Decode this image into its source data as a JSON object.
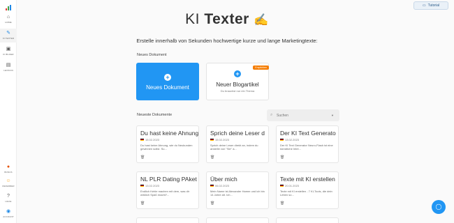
{
  "sidebar": {
    "items": [
      {
        "label": "Home",
        "icon": "home-icon",
        "glyph": "⌂"
      },
      {
        "label": "KI Texter",
        "icon": "pen-icon",
        "glyph": "✎"
      },
      {
        "label": "KI Bilder",
        "icon": "image-icon",
        "glyph": "▣"
      },
      {
        "label": "Lexikon",
        "icon": "book-icon",
        "glyph": "▤"
      }
    ],
    "bottom": [
      {
        "label": "Bonus",
        "icon": "gift-icon",
        "glyph": "●"
      },
      {
        "label": "Referrer",
        "icon": "smile-icon",
        "glyph": "☺"
      },
      {
        "label": "Hilfe",
        "icon": "help-icon",
        "glyph": "?"
      },
      {
        "label": "Account",
        "icon": "account-icon",
        "glyph": "◉"
      }
    ]
  },
  "header": {
    "tutorial_label": "Tutorial",
    "title_light": "KI ",
    "title_bold": "Texter",
    "title_emoji": "✍",
    "subtitle": "Erstelle innerhalb von Sekunden hochwertige kurze und lange Marketingtexte:"
  },
  "new_doc": {
    "section": "Neues Dokument",
    "primary_label": "Neues Dokument",
    "blog_label": "Neuer Blogartikel",
    "blog_sub": "Du brauchst nur ein Thema",
    "blog_badge": "Empfohlen"
  },
  "recent": {
    "section": "Neueste Dokumente",
    "search_placeholder": "Suchen",
    "docs": [
      {
        "title": "Du hast keine Ahnung",
        "date": "15.02.2023",
        "excerpt": "Du hast keine Ahnung, wie du Neukunden gewinnen sollst. Su..."
      },
      {
        "title": "Sprich deine Leser d",
        "date": "15.02.2023",
        "excerpt": "Sprich deine Leser direkt an, indem du anstelle von \"Sie\" a..."
      },
      {
        "title": "Der KI Text Generato",
        "date": "13.02.2023",
        "excerpt": "Der KI Text Generator Neuro-Flash ist eine künstliche Intel..."
      },
      {
        "title": "NL PLR Dating PAket",
        "date": "13.02.2023",
        "excerpt": "Endlich Kehle machen mit dem, was dir wirklich Spaß macht?..."
      },
      {
        "title": "Über mich",
        "date": "06.02.2023",
        "excerpt": "Mein Name ist Alexander Hamm und ich bin 14 Jahre alt. Ich..."
      },
      {
        "title": "Texte mit KI erstellen",
        "date": "20.01.2023",
        "excerpt": "Texte mit KI erstellen - 7 KI-Tools, die dein Leben so..."
      }
    ]
  },
  "fab_icon": "chat-icon",
  "colors": {
    "accent": "#2196f3",
    "badge": "#f57c00"
  }
}
